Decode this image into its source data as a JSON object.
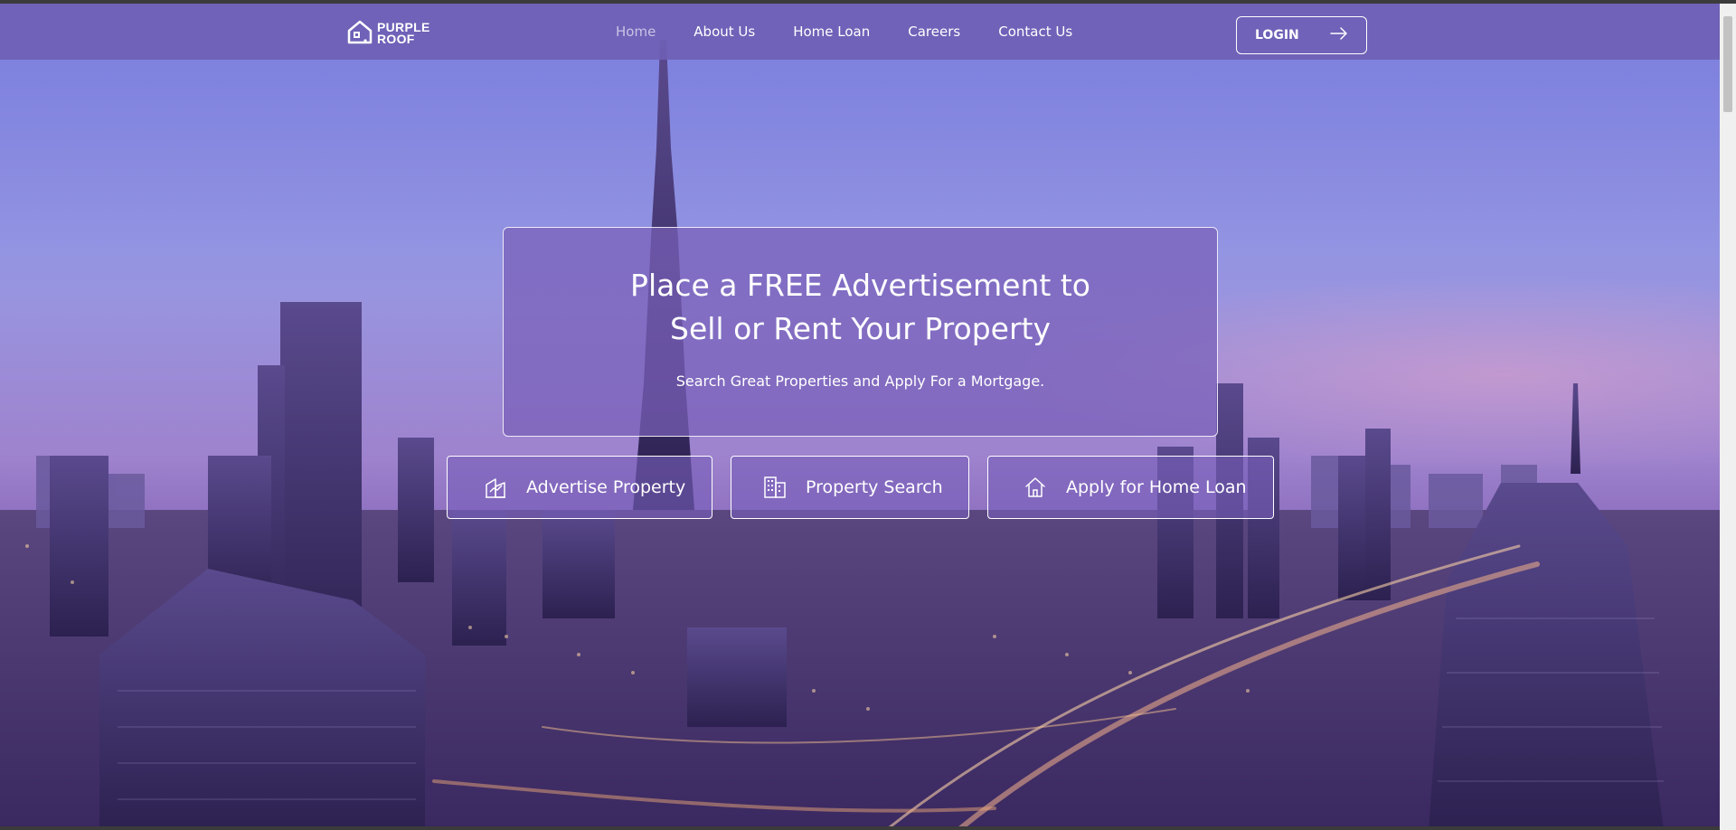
{
  "brand": {
    "line1": "PURPLE",
    "line2": "ROOF",
    "icon": "house-icon"
  },
  "nav": {
    "items": [
      {
        "label": "Home",
        "active": true
      },
      {
        "label": "About Us",
        "active": false
      },
      {
        "label": "Home Loan",
        "active": false
      },
      {
        "label": "Careers",
        "active": false
      },
      {
        "label": "Contact Us",
        "active": false
      }
    ],
    "login_label": "LOGIN",
    "login_icon": "arrow-right-icon"
  },
  "hero": {
    "title_line1": "Place a FREE Advertisement to",
    "title_line2": "Sell or Rent Your Property",
    "subtitle": "Search Great Properties and Apply For a Mortgage."
  },
  "actions": [
    {
      "label": "Advertise Property",
      "icon": "property-chart-icon"
    },
    {
      "label": "Property Search",
      "icon": "building-icon"
    },
    {
      "label": "Apply for Home Loan",
      "icon": "house-icon"
    }
  ],
  "colors": {
    "navbar": "#6e5fb4",
    "overlay": "#785fb9",
    "text": "#ffffff",
    "active_nav": "#c9c3e6"
  }
}
